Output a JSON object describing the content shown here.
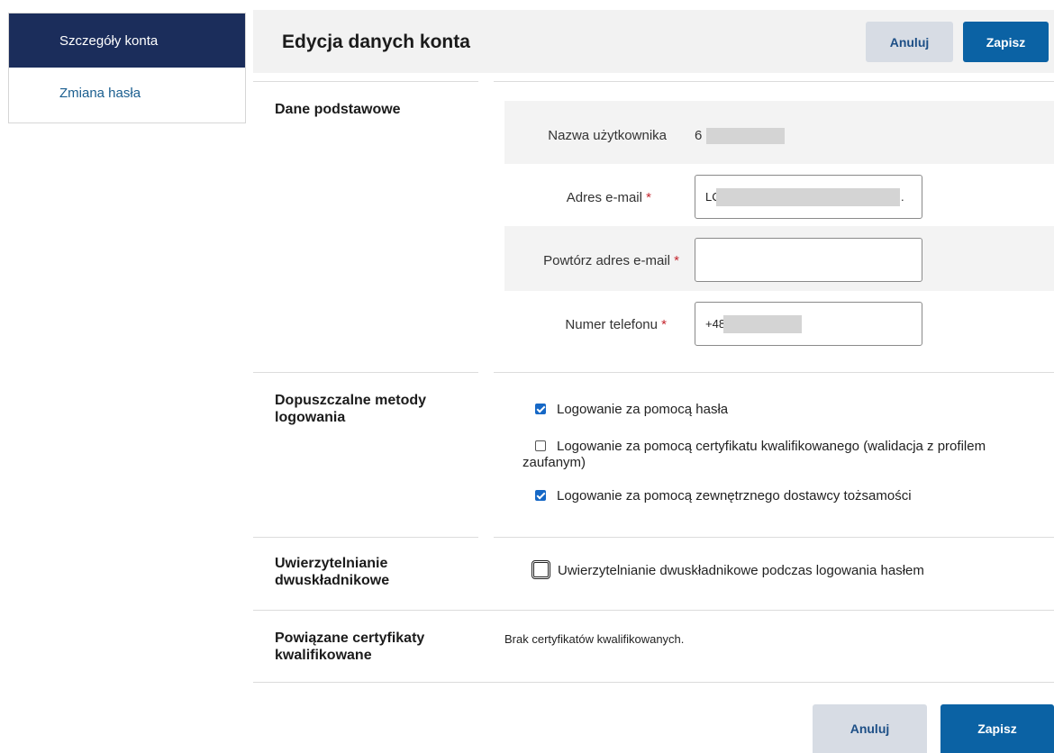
{
  "sidebar": {
    "items": [
      {
        "label": "Szczegóły konta",
        "active": true
      },
      {
        "label": "Zmiana hasła",
        "active": false
      }
    ]
  },
  "header": {
    "title": "Edycja danych konta",
    "cancel_label": "Anuluj",
    "save_label": "Zapisz"
  },
  "basic_data": {
    "section_label": "Dane podstawowe",
    "username_label": "Nazwa użytkownika",
    "username_value": "6",
    "email_label": "Adres e-mail",
    "email_value": "LC",
    "email_trailing": ".",
    "repeat_email_label": "Powtórz adres e-mail",
    "repeat_email_value": "",
    "phone_label": "Numer telefonu",
    "phone_value": "+48(",
    "required_marker": "*"
  },
  "login_methods": {
    "section_label": "Dopuszczalne metody logowania",
    "options": [
      {
        "label": "Logowanie za pomocą hasła",
        "checked": true
      },
      {
        "label": "Logowanie za pomocą certyfikatu kwalifikowanego (walidacja z profilem zaufanym)",
        "checked": false
      },
      {
        "label": "Logowanie za pomocą zewnętrznego dostawcy tożsamości",
        "checked": true
      }
    ]
  },
  "two_factor": {
    "section_label": "Uwierzytelnianie dwuskładnikowe",
    "option_label": "Uwierzytelnianie dwuskładnikowe podczas logowania hasłem",
    "checked": false
  },
  "certificates": {
    "section_label": "Powiązane certyfikaty kwalifikowane",
    "empty_text": "Brak certyfikatów kwalifikowanych."
  },
  "footer": {
    "cancel_label": "Anuluj",
    "save_label": "Zapisz"
  },
  "colors": {
    "sidebar_active": "#1b2d5b",
    "primary_button": "#0b62a4",
    "secondary_button": "#d7dce4",
    "required": "#c4262e",
    "checkbox": "#1668c6"
  }
}
